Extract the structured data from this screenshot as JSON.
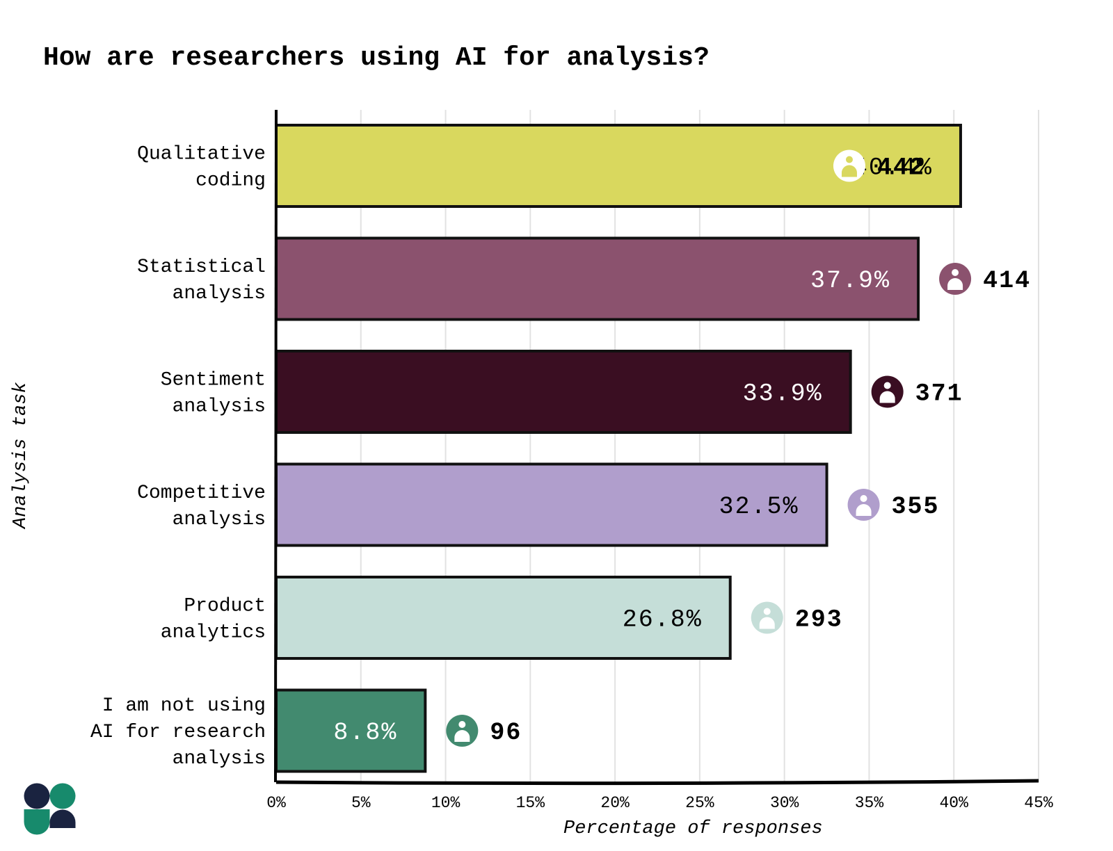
{
  "chart_data": {
    "type": "bar",
    "orientation": "horizontal",
    "title": "How are researchers using AI for analysis?",
    "xlabel": "Percentage of responses",
    "ylabel": "Analysis task",
    "xlim": [
      0,
      45
    ],
    "xticks": [
      "0%",
      "5%",
      "10%",
      "15%",
      "20%",
      "25%",
      "30%",
      "35%",
      "40%",
      "45%"
    ],
    "grid": true,
    "categories": [
      [
        "Qualitative",
        "coding"
      ],
      [
        "Statistical",
        "analysis"
      ],
      [
        "Sentiment",
        "analysis"
      ],
      [
        "Competitive",
        "analysis"
      ],
      [
        "Product",
        "analytics"
      ],
      [
        "I am not using",
        "AI for research",
        "analysis"
      ]
    ],
    "values": [
      40.4,
      37.9,
      33.9,
      32.5,
      26.8,
      8.8
    ],
    "value_labels": [
      "40.4%",
      "37.9%",
      "33.9%",
      "32.5%",
      "26.8%",
      "8.8%"
    ],
    "counts": [
      "442",
      "414",
      "371",
      "355",
      "293",
      "96"
    ],
    "count_icon": "person-icon",
    "colors": [
      "#d9d85e",
      "#8b526e",
      "#3a0e22",
      "#b09ecc",
      "#c5ded8",
      "#428a6f"
    ],
    "label_colors": [
      "#000000",
      "#ffffff",
      "#ffffff",
      "#000000",
      "#000000",
      "#ffffff"
    ]
  },
  "logo": {
    "colors": [
      "#1a2340",
      "#178a6c"
    ]
  }
}
